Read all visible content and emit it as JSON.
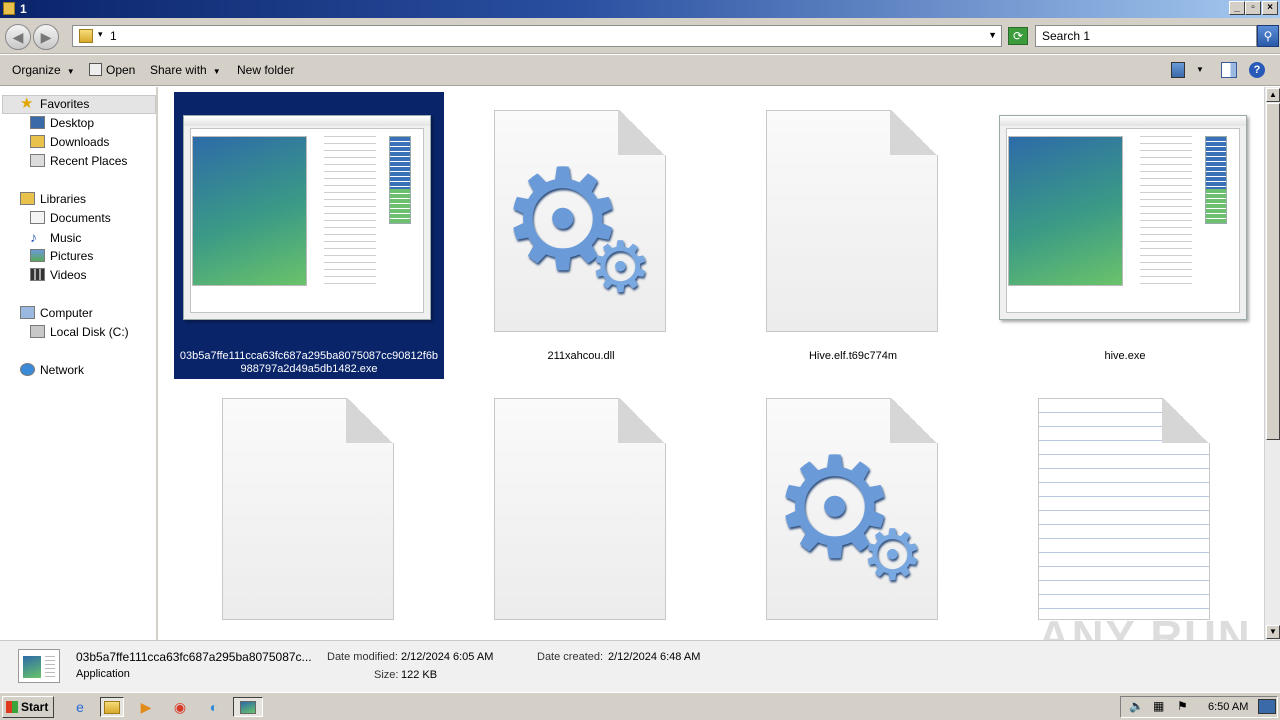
{
  "window": {
    "title": "1"
  },
  "address": {
    "path": "1",
    "search_placeholder": "Search 1"
  },
  "toolbar": {
    "organize": "Organize",
    "open": "Open",
    "share_with": "Share with",
    "new_folder": "New folder"
  },
  "sidebar": {
    "favorites": {
      "label": "Favorites",
      "items": [
        "Desktop",
        "Downloads",
        "Recent Places"
      ]
    },
    "libraries": {
      "label": "Libraries",
      "items": [
        "Documents",
        "Music",
        "Pictures",
        "Videos"
      ]
    },
    "computer": {
      "label": "Computer",
      "items": [
        "Local Disk (C:)"
      ]
    },
    "network": {
      "label": "Network"
    }
  },
  "files": [
    {
      "name": "03b5a7ffe111cca63fc687a295ba8075087cc90812f6b988797a2d49a5db1482.exe",
      "icon": "application-window-icon",
      "selected": true
    },
    {
      "name": "211xahcou.dll",
      "icon": "gears-icon"
    },
    {
      "name": "Hive.elf.t69c774m",
      "icon": "blank-file-icon"
    },
    {
      "name": "hive.exe",
      "icon": "application-window-icon"
    },
    {
      "name": "",
      "icon": "blank-file-icon"
    },
    {
      "name": "",
      "icon": "blank-file-icon"
    },
    {
      "name": "",
      "icon": "gears-icon"
    },
    {
      "name": "",
      "icon": "text-document-icon"
    }
  ],
  "details": {
    "name": "03b5a7ffe111cca63fc687a295ba8075087c...",
    "type": "Application",
    "modified_label": "Date modified:",
    "modified_value": "2/12/2024 6:05 AM",
    "created_label": "Date created:",
    "created_value": "2/12/2024 6:48 AM",
    "size_label": "Size:",
    "size_value": "122 KB"
  },
  "taskbar": {
    "start": "Start",
    "clock": "6:50 AM"
  },
  "watermark": "ANY RUN",
  "colors": {
    "selection": "#0a246a",
    "titlebar": "#0a246a",
    "chrome": "#d4d0c8"
  }
}
